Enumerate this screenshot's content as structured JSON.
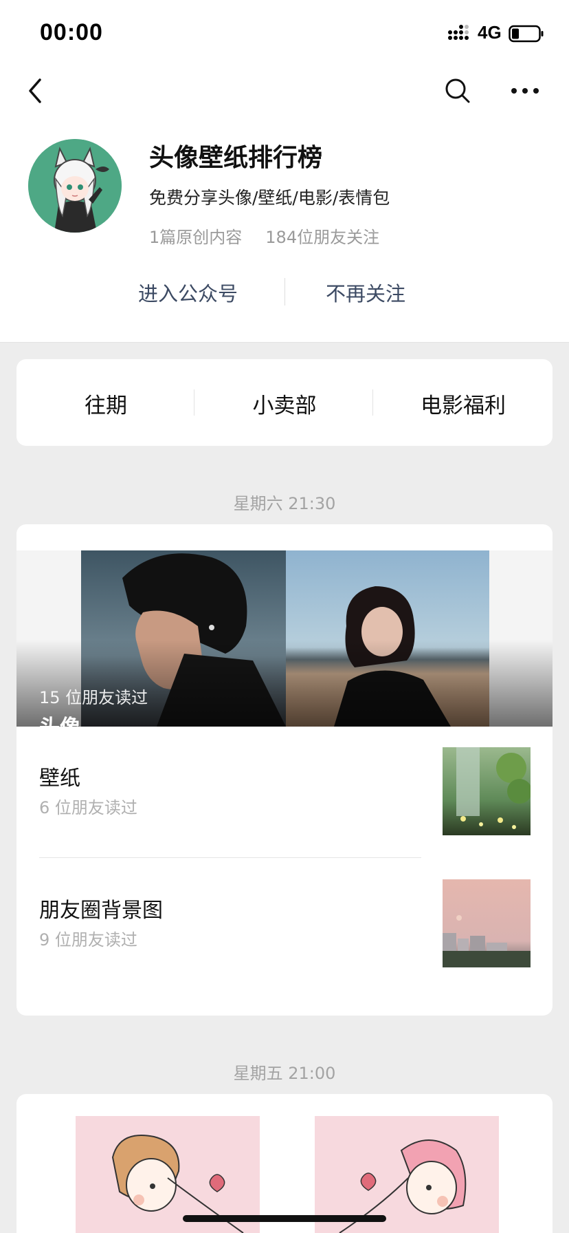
{
  "status_bar": {
    "time": "00:00",
    "network": "4G",
    "icons": [
      "signal-icon",
      "battery-icon"
    ]
  },
  "nav": {
    "icons": [
      "back-icon",
      "search-icon",
      "more-icon"
    ]
  },
  "account": {
    "name": "头像壁纸排行榜",
    "description": "免费分享头像/壁纸/电影/表情包",
    "original_count": "1篇原创内容",
    "followers": "184位朋友关注",
    "avatar_color": "#4ea885"
  },
  "actions": {
    "enter": "进入公众号",
    "unfollow": "不再关注",
    "color": "#3c4a63"
  },
  "menu": {
    "items": [
      "往期",
      "小卖部",
      "电影福利"
    ]
  },
  "posts": [
    {
      "date": "星期六 21:30",
      "main": {
        "reads": "15 位朋友读过",
        "title": "头像"
      },
      "subs": [
        {
          "title": "壁纸",
          "reads": "6 位朋友读过"
        },
        {
          "title": "朋友圈背景图",
          "reads": "9 位朋友读过"
        }
      ]
    },
    {
      "date": "星期五 21:00"
    }
  ]
}
